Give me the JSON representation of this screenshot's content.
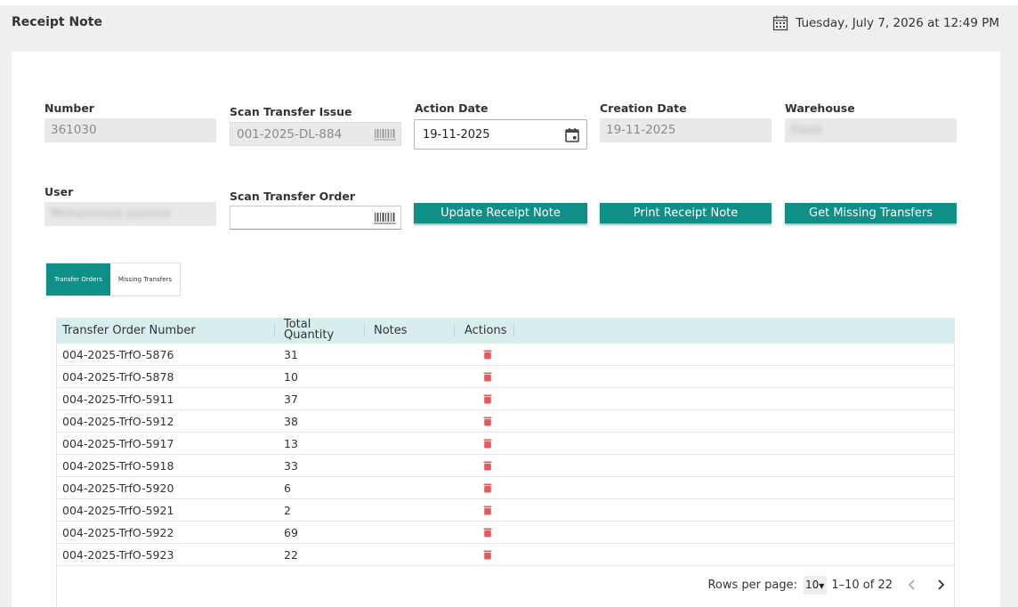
{
  "page": {
    "title": "Receipt Note",
    "datetime": "Tuesday, July 7, 2026 at 12:49 PM"
  },
  "form": {
    "number": {
      "label": "Number",
      "value": "361030"
    },
    "scan_transfer_issue": {
      "label": "Scan Transfer Issue",
      "value": "001-2025-DL-884"
    },
    "action_date": {
      "label": "Action Date",
      "value": "19-11-2025"
    },
    "creation_date": {
      "label": "Creation Date",
      "value": "19-11-2025"
    },
    "warehouse": {
      "label": "Warehouse",
      "value": "Kasik"
    },
    "user": {
      "label": "User",
      "value": "Mohammad yassine"
    },
    "scan_transfer_order": {
      "label": "Scan Transfer Order",
      "value": ""
    }
  },
  "buttons": {
    "update": "Update Receipt Note",
    "print": "Print Receipt Note",
    "missing": "Get Missing Transfers"
  },
  "tabs": [
    {
      "label": "Transfer Orders",
      "active": true
    },
    {
      "label": "Missing Transfers",
      "active": false
    }
  ],
  "table": {
    "columns": [
      "Transfer Order Number",
      "Total Quantity",
      "Notes",
      "Actions"
    ],
    "rows": [
      {
        "number": "004-2025-TrfO-5876",
        "qty": "31",
        "notes": ""
      },
      {
        "number": "004-2025-TrfO-5878",
        "qty": "10",
        "notes": ""
      },
      {
        "number": "004-2025-TrfO-5911",
        "qty": "37",
        "notes": ""
      },
      {
        "number": "004-2025-TrfO-5912",
        "qty": "38",
        "notes": ""
      },
      {
        "number": "004-2025-TrfO-5917",
        "qty": "13",
        "notes": ""
      },
      {
        "number": "004-2025-TrfO-5918",
        "qty": "33",
        "notes": ""
      },
      {
        "number": "004-2025-TrfO-5920",
        "qty": "6",
        "notes": ""
      },
      {
        "number": "004-2025-TrfO-5921",
        "qty": "2",
        "notes": ""
      },
      {
        "number": "004-2025-TrfO-5922",
        "qty": "69",
        "notes": ""
      },
      {
        "number": "004-2025-TrfO-5923",
        "qty": "22",
        "notes": ""
      }
    ]
  },
  "pagination": {
    "rows_per_page_label": "Rows per page:",
    "rows_per_page": "10",
    "range": "1–10 of 22"
  },
  "colors": {
    "accent": "#0e8f87",
    "table_header_bg": "#d8eeee",
    "delete_icon": "#e45a5a"
  },
  "icons": {
    "datetime": "calendar-icon",
    "scan": "barcode-icon",
    "date_picker": "calendar-icon",
    "row_action": "trash-icon",
    "prev_page": "chevron-left-icon",
    "next_page": "chevron-right-icon"
  }
}
